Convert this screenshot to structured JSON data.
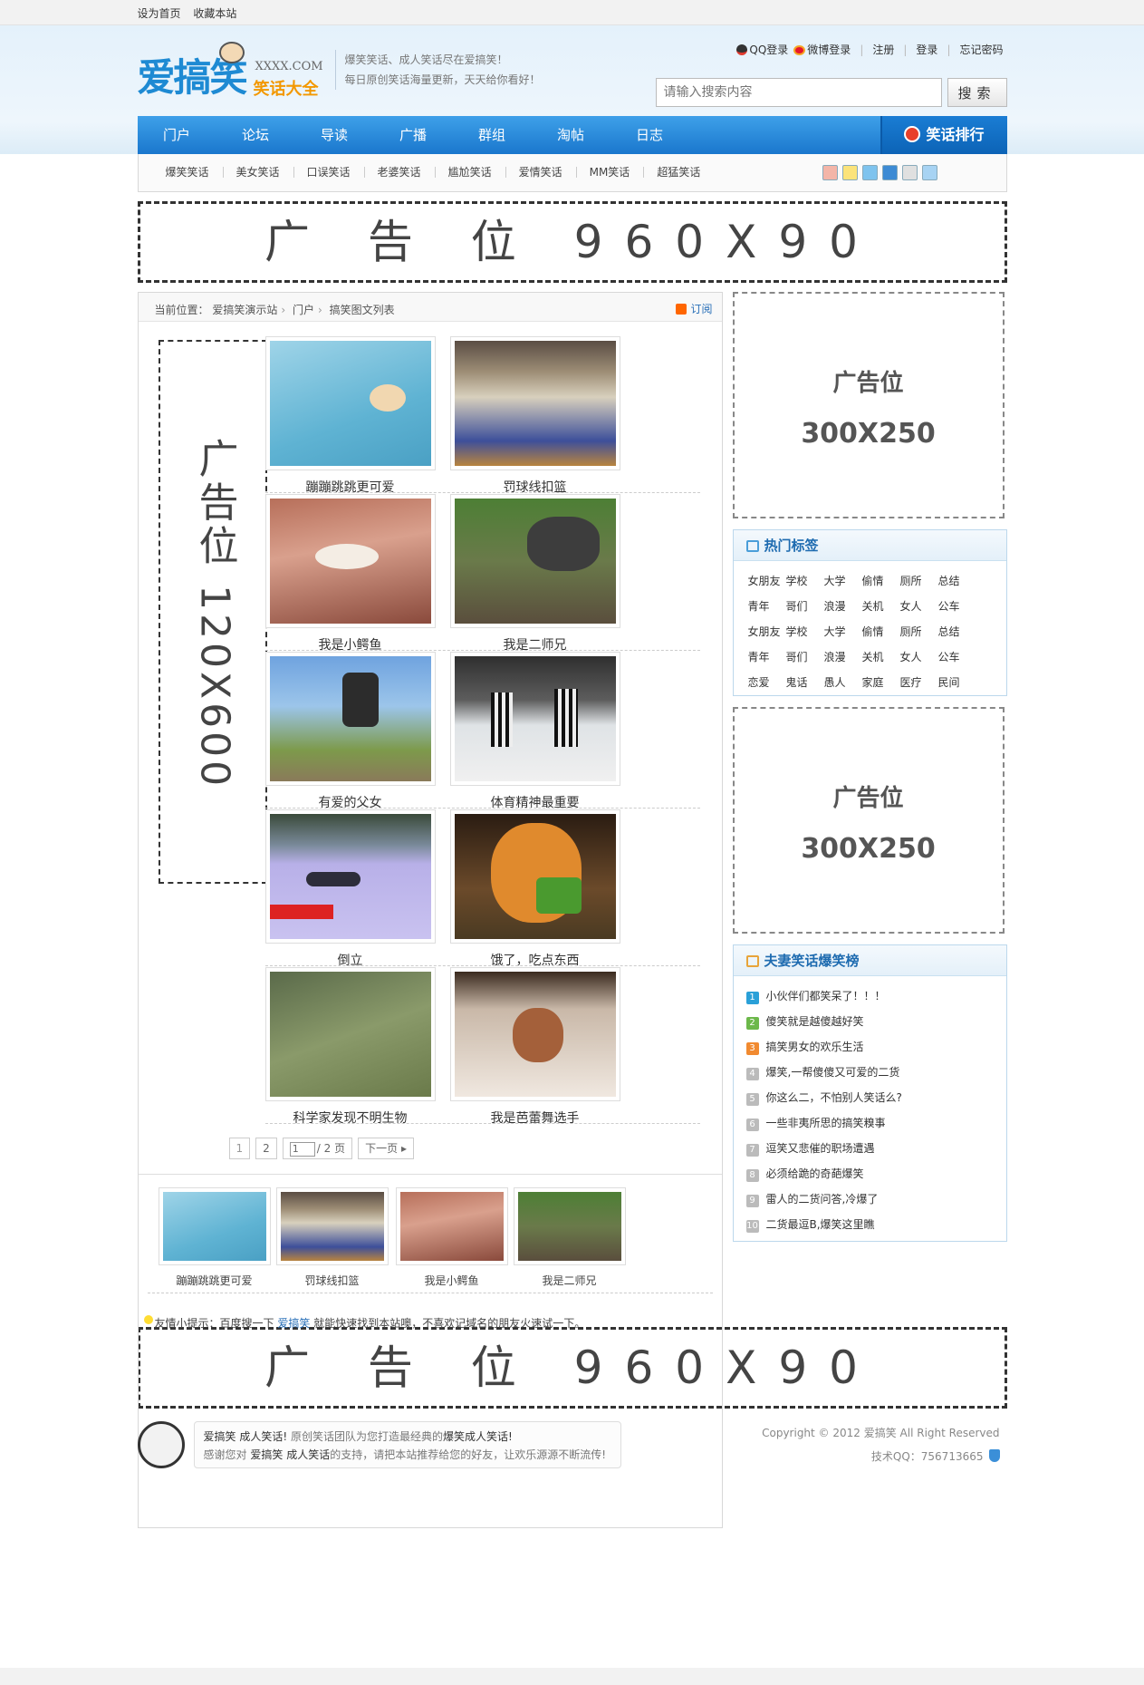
{
  "topbar": {
    "set_home": "设为首页",
    "bookmark": "收藏本站"
  },
  "logo": {
    "main": "爱搞笑",
    "domain": "XXXX.COM",
    "sub": "笑话大全"
  },
  "slogan": {
    "line1": "爆笑笑话、成人笑话尽在爱搞笑！",
    "line2": "每日原创笑话海量更新，天天给你看好！"
  },
  "login": {
    "qq": "QQ登录",
    "weibo": "微博登录",
    "register": "注册",
    "login": "登录",
    "forgot": "忘记密码"
  },
  "search": {
    "placeholder": "请输入搜索内容",
    "button": "搜索"
  },
  "nav": {
    "items": [
      "门户",
      "论坛",
      "导读",
      "广播",
      "群组",
      "淘帖",
      "日志"
    ],
    "rank": "笑话排行"
  },
  "subnav": {
    "items": [
      "爆笑笑话",
      "美女笑话",
      "口误笑话",
      "老婆笑话",
      "尴尬笑话",
      "爱情笑话",
      "MM笑话",
      "超猛笑话"
    ]
  },
  "ad_wide": "广 告 位 960X90",
  "breadcrumb": {
    "label": "当前位置：",
    "site": "爱搞笑演示站",
    "portal": "门户",
    "page": "搞笑图文列表",
    "rss": "订阅"
  },
  "ad_tall": "广告位 120X600",
  "grid": [
    {
      "caption": "蹦蹦跳跳更可爱"
    },
    {
      "caption": "罚球线扣篮"
    },
    {
      "caption": "我是小鳄鱼"
    },
    {
      "caption": "我是二师兄"
    },
    {
      "caption": "有爱的父女"
    },
    {
      "caption": "体育精神最重要"
    },
    {
      "caption": "倒立"
    },
    {
      "caption": "饿了，吃点东西"
    },
    {
      "caption": "科学家发现不明生物"
    },
    {
      "caption": "我是芭蕾舞选手"
    }
  ],
  "pager": {
    "p1": "1",
    "p2": "2",
    "input": "1",
    "total": "/ 2 页",
    "next": "下一页"
  },
  "related": [
    "蹦蹦跳跳更可爱",
    "罚球线扣篮",
    "我是小鳄鱼",
    "我是二师兄"
  ],
  "tip": {
    "prefix": "友情小提示：百度搜一下",
    "keyword": "爱搞笑",
    "suffix": "就能快速找到本站噢，不喜欢记域名的朋友火速试一下。"
  },
  "ad300": {
    "label": "广告位",
    "size": "300X250"
  },
  "hot_tags": {
    "title": "热门标签",
    "rows": [
      [
        "女朋友",
        "学校",
        "大学",
        "偷情",
        "厕所",
        "总结"
      ],
      [
        "青年",
        "哥们",
        "浪漫",
        "关机",
        "女人",
        "公车"
      ],
      [
        "女朋友",
        "学校",
        "大学",
        "偷情",
        "厕所",
        "总结"
      ],
      [
        "青年",
        "哥们",
        "浪漫",
        "关机",
        "女人",
        "公车"
      ],
      [
        "恋爱",
        "鬼话",
        "愚人",
        "家庭",
        "医疗",
        "民间"
      ]
    ]
  },
  "rank_box": {
    "title": "夫妻笑话爆笑榜",
    "items": [
      "小伙伴们都笑呆了！！！",
      "傻笑就是越傻越好笑",
      "搞笑男女的欢乐生活",
      "爆笑,一帮傻傻又可爱的二货",
      "你这么二，不怕别人笑话么?",
      "一些非夷所思的搞笑糗事",
      "逗笑又悲催的职场遭遇",
      "必须给跪的奇葩爆笑",
      "雷人的二货问答,冷爆了",
      "二货最逗B,爆笑这里瞧"
    ]
  },
  "footer": {
    "line1_brand": "爱搞笑",
    "line1_a": "成人笑话!",
    "line1_b": "原创笑话团队为您打造最经典的",
    "line1_c": "爆笑成人笑话!",
    "line2_a": "感谢您对",
    "line2_brand": "爱搞笑",
    "line2_b": "成人笑话",
    "line2_c": "的支持，请把本站推荐给您的好友，让欢乐源源不断流传!",
    "copyright": "Copyright © 2012 爱搞笑 All Right Reserved",
    "qq": "技术QQ：756713665"
  }
}
